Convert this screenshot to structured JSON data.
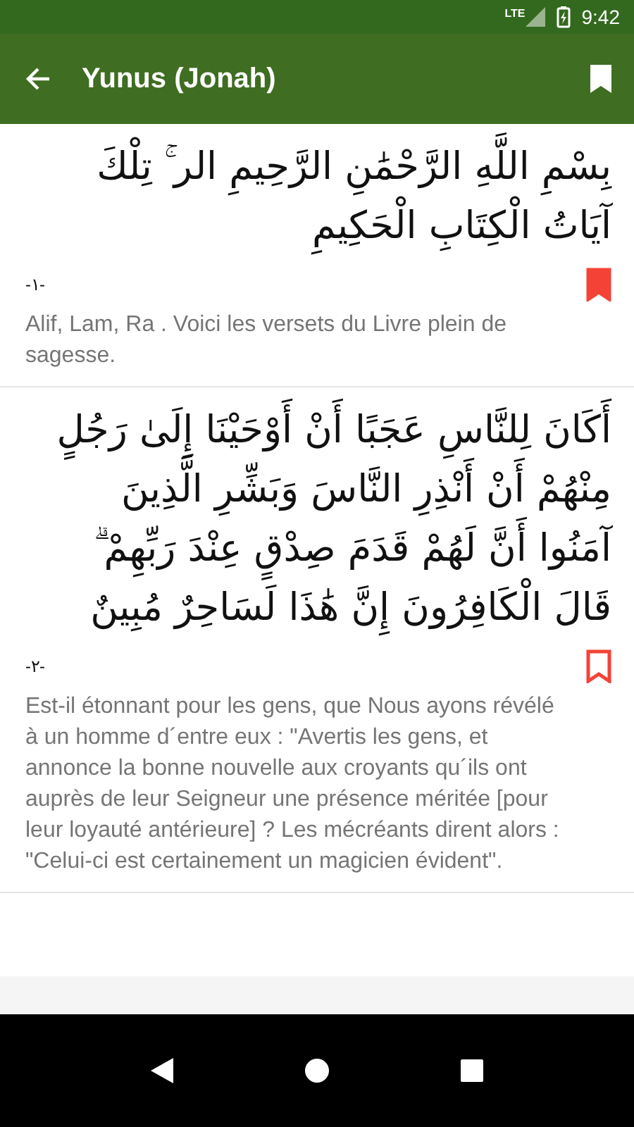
{
  "status_bar": {
    "network": "LTE",
    "time": "9:42"
  },
  "app_bar": {
    "title": "Yunus (Jonah)"
  },
  "verses": [
    {
      "arabic": "بِسْمِ اللَّهِ الرَّحْمَٰنِ الرَّحِيمِ الر ۚ تِلْكَ آيَاتُ الْكِتَابِ الْحَكِيمِ",
      "number": "-١-",
      "bookmarked": true,
      "translation": "Alif, Lam, Ra . Voici les versets du Livre plein de sagesse."
    },
    {
      "arabic": "أَكَانَ لِلنَّاسِ عَجَبًا أَنْ أَوْحَيْنَا إِلَىٰ رَجُلٍ مِنْهُمْ أَنْ أَنْذِرِ النَّاسَ وَبَشِّرِ الَّذِينَ آمَنُوا أَنَّ لَهُمْ قَدَمَ صِدْقٍ عِنْدَ رَبِّهِمْ ۗ قَالَ الْكَافِرُونَ إِنَّ هَٰذَا لَسَاحِرٌ مُبِينٌ",
      "number": "-٢-",
      "bookmarked": false,
      "translation": "Est-il étonnant pour les gens, que Nous ayons révélé à un homme d´entre eux : \"Avertis les gens, et annonce la bonne nouvelle aux croyants qu´ils ont auprès de leur Seigneur une présence méritée [pour leur loyauté antérieure] ? Les mécréants dirent alors : \"Celui-ci est certainement un magicien évident\"."
    }
  ]
}
